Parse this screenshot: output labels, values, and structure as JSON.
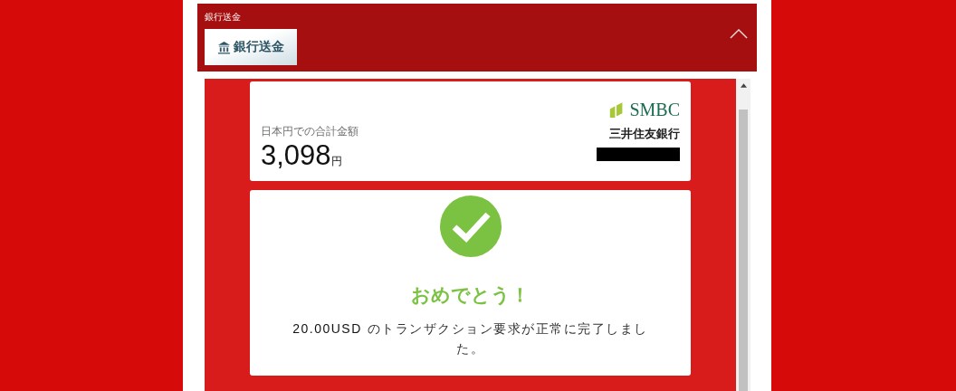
{
  "section": {
    "label": "銀行送金",
    "badge": "銀行送金",
    "expanded": true
  },
  "summary": {
    "caption": "日本円での合計金額",
    "amount": "3,098",
    "unit": "円",
    "bank_logo": "SMBC",
    "bank_name": "三井住友銀行"
  },
  "result": {
    "title": "おめでとう！",
    "message": "**20.00USD** のトランザクション要求が正常に完了しました。"
  }
}
